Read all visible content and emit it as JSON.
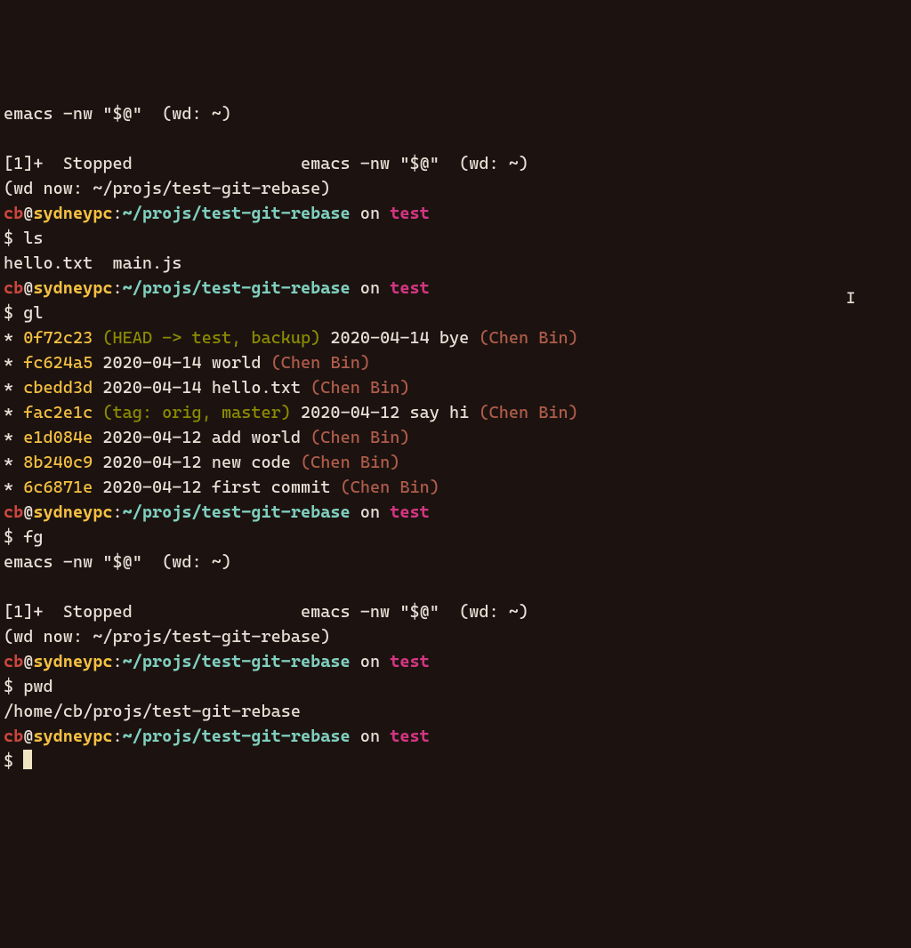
{
  "prompt": {
    "user": "cb",
    "at": "@",
    "host": "sydneypc",
    "colon": ":",
    "path": "~/projs/test-git-rebase",
    "on": " on ",
    "branch": "test",
    "ps1": "$ "
  },
  "history": {
    "emacs_wd": "emacs -nw \"$@\"  (wd: ~)",
    "blank": "",
    "stopped": "[1]+  Stopped                 emacs -nw \"$@\"  (wd: ~)",
    "wd_now": "(wd now: ~/projs/test-git-rebase)",
    "cmd_ls": "ls",
    "ls_out": "hello.txt  main.js",
    "cmd_gl": "gl",
    "cmd_fg": "fg",
    "cmd_pwd": "pwd",
    "pwd_out": "/home/cb/projs/test-git-rebase"
  },
  "gitlog": [
    {
      "star": "*",
      "hash": "0f72c23",
      "refs": "(HEAD -> test, backup)",
      "date": "2020-04-14",
      "msg": "bye",
      "author": "(Chen Bin)"
    },
    {
      "star": "*",
      "hash": "fc624a5",
      "refs": "",
      "date": "2020-04-14",
      "msg": "world",
      "author": "(Chen Bin)"
    },
    {
      "star": "*",
      "hash": "cbedd3d",
      "refs": "",
      "date": "2020-04-14",
      "msg": "hello.txt",
      "author": "(Chen Bin)"
    },
    {
      "star": "*",
      "hash": "fac2e1c",
      "refs": "(tag: orig, master)",
      "date": "2020-04-12",
      "msg": "say hi",
      "author": "(Chen Bin)"
    },
    {
      "star": "*",
      "hash": "e1d084e",
      "refs": "",
      "date": "2020-04-12",
      "msg": "add world",
      "author": "(Chen Bin)"
    },
    {
      "star": "*",
      "hash": "8b240c9",
      "refs": "",
      "date": "2020-04-12",
      "msg": "new code",
      "author": "(Chen Bin)"
    },
    {
      "star": "*",
      "hash": "6c6871e",
      "refs": "",
      "date": "2020-04-12",
      "msg": "first commit",
      "author": "(Chen Bin)"
    }
  ],
  "ibeam": "I"
}
